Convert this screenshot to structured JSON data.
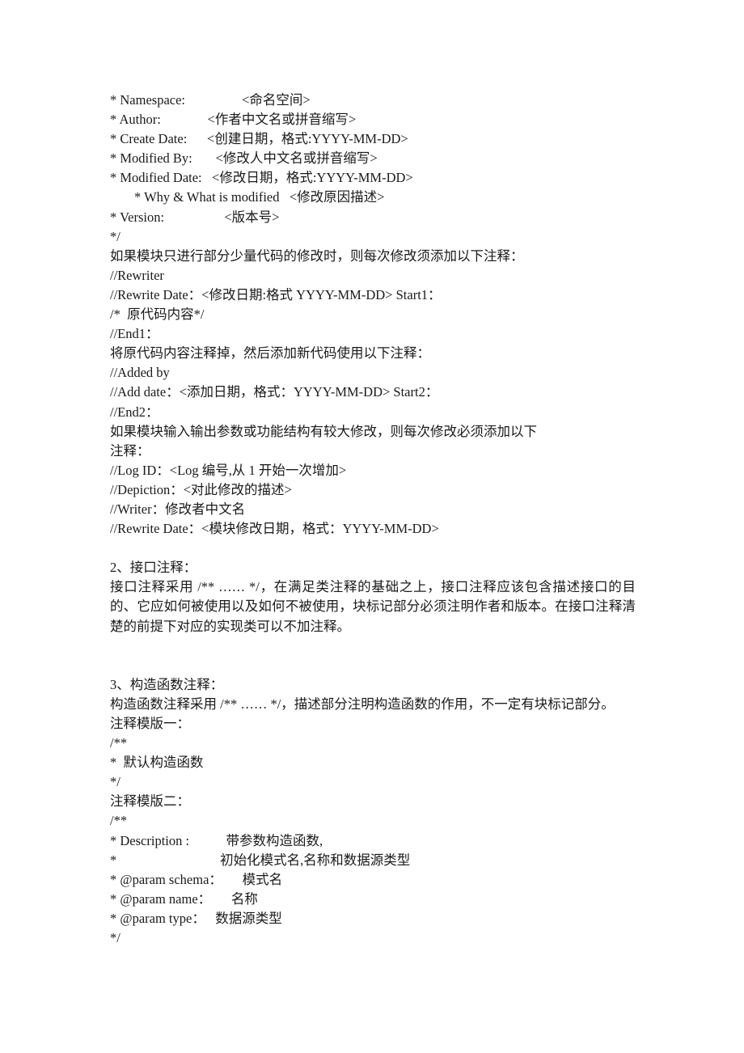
{
  "document": {
    "blocks": [
      {
        "type": "line",
        "name": "line-namespace",
        "text": "* Namespace:                 <命名空间>"
      },
      {
        "type": "line",
        "name": "line-author",
        "text": "* Author:              <作者中文名或拼音缩写>"
      },
      {
        "type": "line",
        "name": "line-create-date",
        "text": "* Create Date:      <创建日期，格式:YYYY-MM-DD>"
      },
      {
        "type": "line",
        "name": "line-modified-by",
        "text": "* Modified By:       <修改人中文名或拼音缩写>"
      },
      {
        "type": "line",
        "name": "line-modified-date",
        "text": "* Modified Date:   <修改日期，格式:YYYY-MM-DD>"
      },
      {
        "type": "line",
        "name": "line-why-what-modified",
        "indent": 1,
        "text": "* Why & What is modified   <修改原因描述>"
      },
      {
        "type": "line",
        "name": "line-version",
        "text": "* Version:                  <版本号>"
      },
      {
        "type": "line",
        "name": "line-block-comment-end",
        "text": "*/"
      },
      {
        "type": "para",
        "name": "para-partial-modify-note",
        "text": "如果模块只进行部分少量代码的修改时，则每次修改须添加以下注释："
      },
      {
        "type": "line",
        "name": "line-rewriter",
        "text": "//Rewriter"
      },
      {
        "type": "line",
        "name": "line-rewrite-date-start1",
        "text": "//Rewrite Date：<修改日期:格式 YYYY-MM-DD> Start1："
      },
      {
        "type": "line",
        "name": "line-original-code",
        "text": "/*  原代码内容*/"
      },
      {
        "type": "line",
        "name": "line-end1",
        "text": "//End1："
      },
      {
        "type": "para",
        "name": "para-comment-out-note",
        "text": "将原代码内容注释掉，然后添加新代码使用以下注释："
      },
      {
        "type": "line",
        "name": "line-added-by",
        "text": "//Added by"
      },
      {
        "type": "line",
        "name": "line-add-date-start2",
        "text": "//Add date：<添加日期，格式：YYYY-MM-DD> Start2："
      },
      {
        "type": "line",
        "name": "line-end2",
        "text": "//End2："
      },
      {
        "type": "para",
        "name": "para-major-modify-note",
        "text": "如果模块输入输出参数或功能结构有较大修改，则每次修改必须添加以下"
      },
      {
        "type": "line",
        "name": "line-note-label",
        "text": "注释："
      },
      {
        "type": "line",
        "name": "line-log-id",
        "text": "//Log ID：<Log 编号,从 1 开始一次增加>"
      },
      {
        "type": "line",
        "name": "line-depiction",
        "text": "//Depiction：<对此修改的描述>"
      },
      {
        "type": "line",
        "name": "line-writer",
        "text": "//Writer：修改者中文名"
      },
      {
        "type": "line",
        "name": "line-rewrite-date",
        "text": "//Rewrite Date：<模块修改日期，格式：YYYY-MM-DD>"
      },
      {
        "type": "blank",
        "name": "spacer-1"
      },
      {
        "type": "line",
        "name": "heading-interface-comment",
        "text": "2、接口注释："
      },
      {
        "type": "para",
        "name": "para-interface-comment",
        "text": "接口注释采用 /** …… */，在满足类注释的基础之上，接口注释应该包含描述接口的目的、它应如何被使用以及如何不被使用，块标记部分必须注明作者和版本。在接口注释清楚的前提下对应的实现类可以不加注释。"
      },
      {
        "type": "blank",
        "name": "spacer-2"
      },
      {
        "type": "blank",
        "name": "spacer-3"
      },
      {
        "type": "line",
        "name": "heading-constructor-comment",
        "text": "3、构造函数注释："
      },
      {
        "type": "para",
        "name": "para-constructor-comment",
        "text": "构造函数注释采用 /** …… */，描述部分注明构造函数的作用，不一定有块标记部分。"
      },
      {
        "type": "line",
        "name": "line-template-one-label",
        "text": "注释模版一："
      },
      {
        "type": "line",
        "name": "line-template-one-open",
        "text": "/**"
      },
      {
        "type": "line",
        "name": "line-default-constructor",
        "text": "*  默认构造函数"
      },
      {
        "type": "line",
        "name": "line-template-one-close",
        "text": "*/"
      },
      {
        "type": "line",
        "name": "line-template-two-label",
        "text": "注释模版二："
      },
      {
        "type": "line",
        "name": "line-template-two-open",
        "text": "/**"
      },
      {
        "type": "line",
        "name": "line-description",
        "text": "* Description :           带参数构造函数,"
      },
      {
        "type": "line",
        "name": "line-description-cont",
        "text": "*                               初始化模式名,名称和数据源类型"
      },
      {
        "type": "line",
        "name": "line-param-schema",
        "text": "* @param schema：      模式名"
      },
      {
        "type": "line",
        "name": "line-param-name",
        "text": "* @param name：      名称"
      },
      {
        "type": "line",
        "name": "line-param-type",
        "text": "* @param type：   数据源类型"
      },
      {
        "type": "line",
        "name": "line-template-two-close",
        "text": "*/"
      }
    ]
  }
}
